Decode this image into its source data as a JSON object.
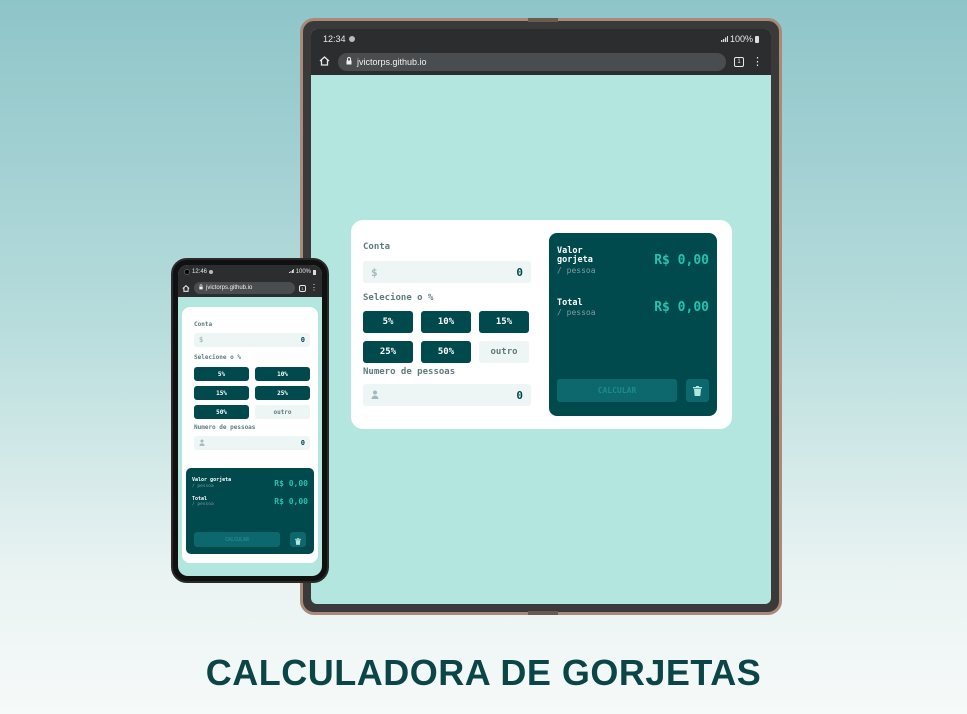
{
  "page_title": "CALCULADORA DE GORJETAS",
  "colors": {
    "dark_teal": "#00494d",
    "accent": "#26c2ae",
    "screen_bg": "#b2e6df",
    "input_bg": "#eef6f5"
  },
  "tablet": {
    "status": {
      "time": "12:34",
      "battery": "100%"
    },
    "browser": {
      "url": "jvictorps.github.io",
      "tab_count": "1"
    },
    "app": {
      "bill_label": "Conta",
      "bill_icon": "$",
      "bill_value": "0",
      "tip_label": "Selecione o %",
      "tips": [
        "5%",
        "10%",
        "15%",
        "25%",
        "50%"
      ],
      "custom_tip": "outro",
      "people_label": "Numero de pessoas",
      "people_value": "0",
      "tip_amount_label": "Valor gorjeta",
      "per_person": "/ pessoa",
      "tip_amount_value": "R$ 0,00",
      "total_label": "Total",
      "total_value": "R$ 0,00",
      "calc_button": "CALCULAR"
    }
  },
  "phone": {
    "status": {
      "time": "12:46",
      "battery": "100%"
    },
    "browser": {
      "url": "jvictorps.github.io",
      "tab_count": "1"
    },
    "app": {
      "bill_label": "Conta",
      "bill_icon": "$",
      "bill_value": "0",
      "tip_label": "Selecione o %",
      "tips": [
        "5%",
        "10%",
        "15%",
        "25%",
        "50%"
      ],
      "custom_tip": "outro",
      "people_label": "Numero de pessoas",
      "people_value": "0",
      "tip_amount_label": "Valor gorjeta",
      "per_person": "/ pessoa",
      "tip_amount_value": "R$ 0,00",
      "total_label": "Total",
      "total_value": "R$ 0,00",
      "calc_button": "CALCULAR"
    }
  }
}
